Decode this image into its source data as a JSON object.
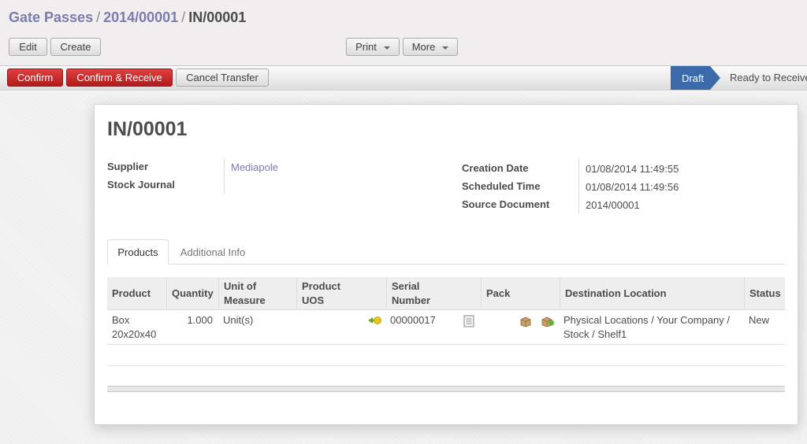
{
  "breadcrumb": {
    "items": [
      "Gate Passes",
      "2014/00001"
    ],
    "current": "IN/00001",
    "separator": "/"
  },
  "toolbar": {
    "edit": "Edit",
    "create": "Create",
    "print": "Print",
    "more": "More"
  },
  "actions": {
    "confirm": "Confirm",
    "confirm_receive": "Confirm & Receive",
    "cancel_transfer": "Cancel Transfer"
  },
  "status_stages": {
    "current": "Draft",
    "next": "Ready to Receive"
  },
  "record": {
    "title": "IN/00001",
    "supplier_label": "Supplier",
    "supplier_value": "Mediapole",
    "stock_journal_label": "Stock Journal",
    "creation_date_label": "Creation Date",
    "creation_date_value": "01/08/2014 11:49:55",
    "scheduled_time_label": "Scheduled Time",
    "scheduled_time_value": "01/08/2014 11:49:56",
    "source_document_label": "Source Document",
    "source_document_value": "2014/00001"
  },
  "tabs": [
    {
      "label": "Products",
      "active": true
    },
    {
      "label": "Additional Info",
      "active": false
    }
  ],
  "table": {
    "headers": {
      "product": "Product",
      "quantity": "Quantity",
      "uom_1": "Unit of",
      "uom_2": "Measure",
      "uos_1": "Product",
      "uos_2": "UOS",
      "serial_1": "Serial",
      "serial_2": "Number",
      "pack": "Pack",
      "destination": "Destination Location",
      "status": "Status"
    },
    "rows": [
      {
        "product_1": "Box",
        "product_2": "20x20x40",
        "quantity": "1.000",
        "uom": "Unit(s)",
        "serial": "00000017",
        "destination_1": "Physical Locations / Your Company /",
        "destination_2": "Stock / Shelf1",
        "status": "New"
      }
    ]
  },
  "colors": {
    "link": "#7c7bad",
    "primary_red": "#c62828",
    "stage_blue": "#3b6aaa"
  }
}
